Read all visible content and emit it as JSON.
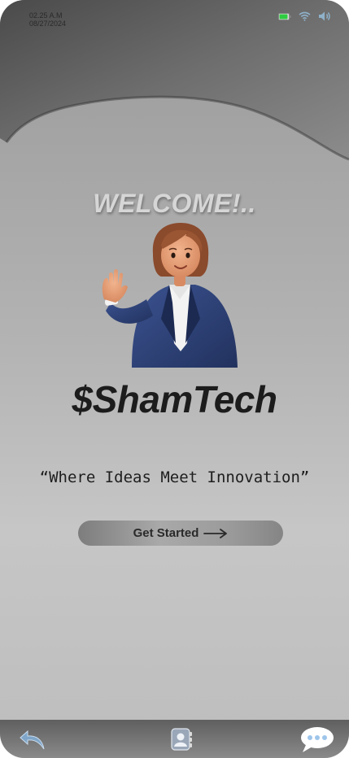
{
  "status_bar": {
    "time": "02.25 A.M",
    "date": "08/27/2024",
    "icons": [
      "battery-icon",
      "wifi-icon",
      "volume-icon"
    ],
    "battery_color": "#2ecc40"
  },
  "hero": {
    "welcome": "WELCOME!..",
    "brand": "$ShamTech",
    "tagline": "“Where Ideas Meet Innovation”"
  },
  "cta": {
    "label": "Get Started",
    "icon": "arrow-right-icon"
  },
  "bottom_nav": {
    "items": [
      "back-icon",
      "contact-book-icon",
      "chat-bubble-icon"
    ]
  },
  "colors": {
    "suit": "#2c3f75",
    "hair": "#8a4a2c",
    "skin": "#e8a17a"
  }
}
